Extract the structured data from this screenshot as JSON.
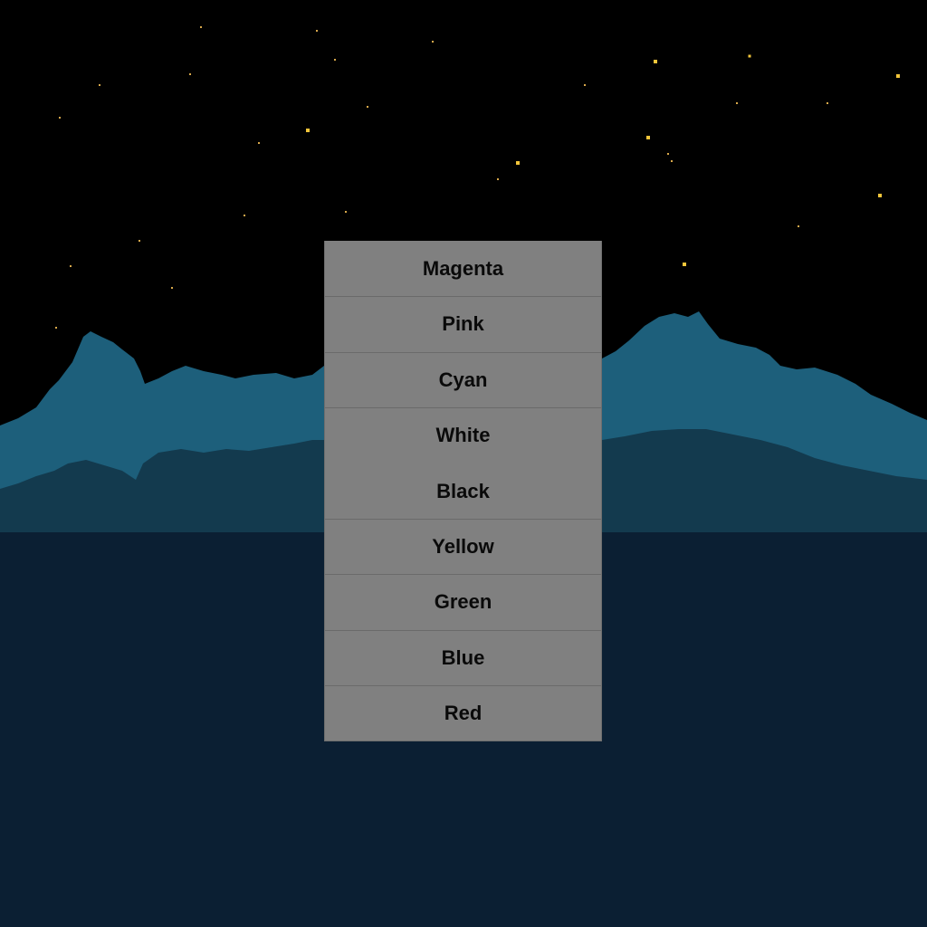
{
  "scene": {
    "sky_color": "#000000",
    "star_color": "#f2c53a",
    "star_dim_color": "#d8a84a",
    "mountain_far_color": "#1d5f7b",
    "mountain_near_color": "#133a4e",
    "water_color": "#0b1f33"
  },
  "menu": {
    "background": "#808080",
    "items": [
      {
        "label": "Magenta",
        "name": "color-option-magenta"
      },
      {
        "label": "Pink",
        "name": "color-option-pink"
      },
      {
        "label": "Cyan",
        "name": "color-option-cyan"
      },
      {
        "label": "White",
        "name": "color-option-white"
      },
      {
        "label": "Black",
        "name": "color-option-black"
      },
      {
        "label": "Yellow",
        "name": "color-option-yellow"
      },
      {
        "label": "Green",
        "name": "color-option-green"
      },
      {
        "label": "Blue",
        "name": "color-option-blue"
      },
      {
        "label": "Red",
        "name": "color-option-red"
      }
    ]
  }
}
